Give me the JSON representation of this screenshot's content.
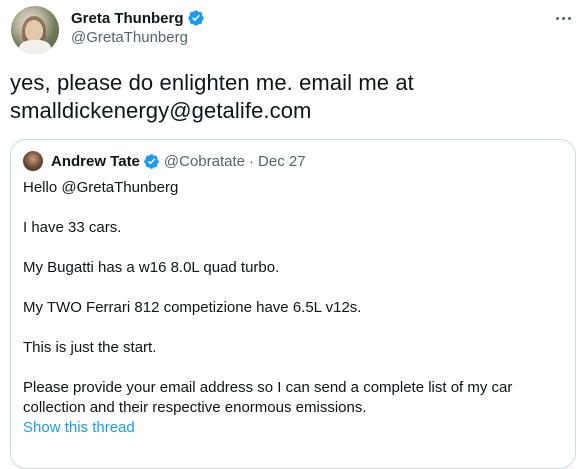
{
  "tweet": {
    "author_name": "Greta Thunberg",
    "author_handle": "@GretaThunberg",
    "text": "yes, please do enlighten me. email me at\nsmalldickenergy@getalife.com",
    "verified_color": "#1d9bf0"
  },
  "quoted_tweet": {
    "author_name": "Andrew Tate",
    "author_handle": "@Cobratate",
    "separator": "·",
    "date": "Dec 27",
    "paragraphs": [
      "Hello @GretaThunberg",
      "I have 33 cars.",
      "My Bugatti has a w16 8.0L quad turbo.",
      "My TWO Ferrari 812 competizione have 6.5L v12s.",
      "This is just the start.",
      "Please provide your email address so I can send a complete list of my car collection and their respective enormous emissions."
    ],
    "show_thread_label": "Show this thread"
  },
  "icons": {
    "more": "more-horizontal-icon",
    "verified": "verified-badge-icon"
  },
  "colors": {
    "link": "#1d9bf0",
    "secondary_text": "#536471",
    "primary_text": "#0f1419",
    "border": "#cfd9de"
  }
}
